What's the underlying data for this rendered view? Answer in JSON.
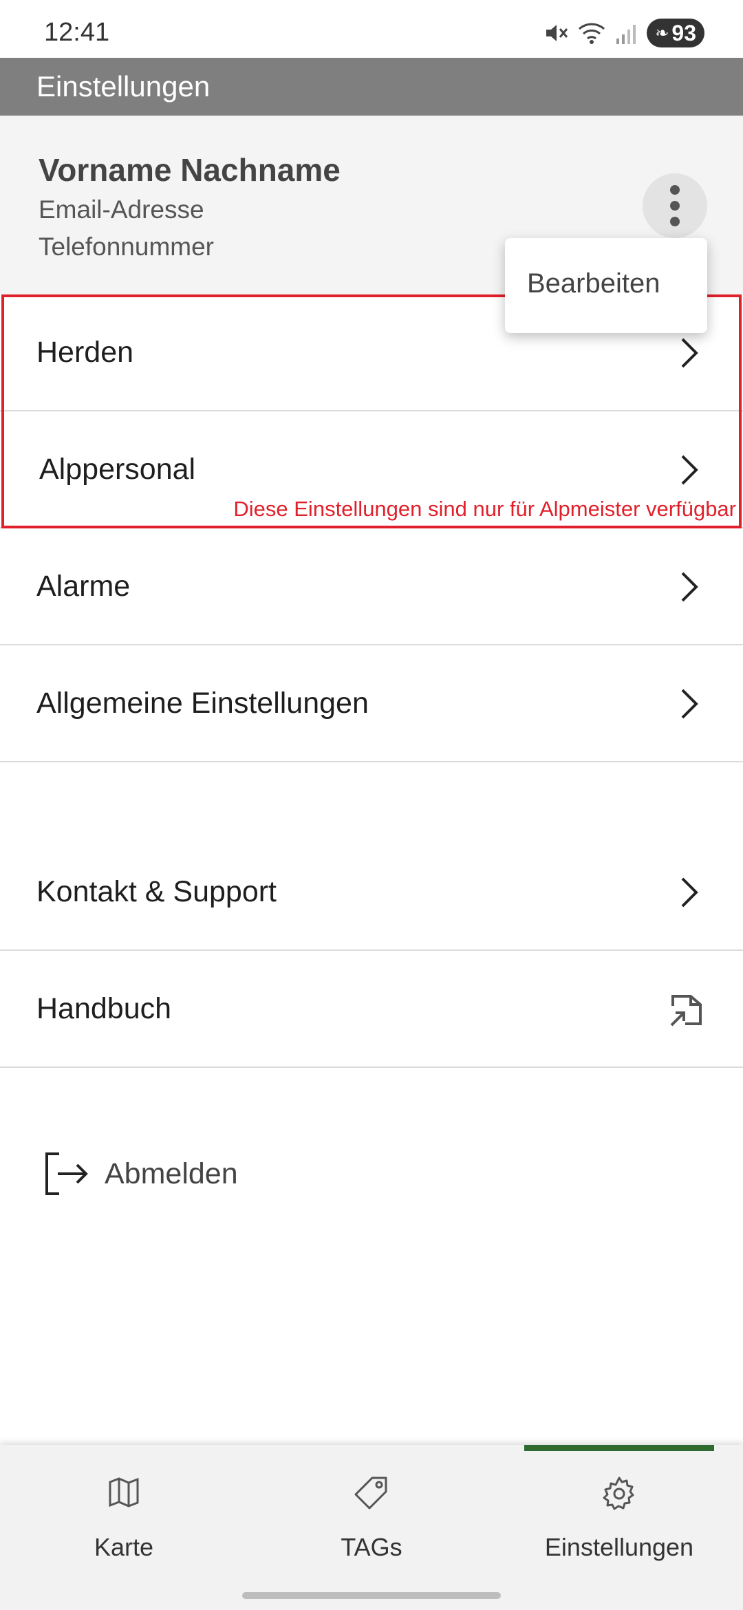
{
  "status_bar": {
    "time": "12:41",
    "battery": "93"
  },
  "app_bar": {
    "title": "Einstellungen"
  },
  "profile": {
    "name": "Vorname Nachname",
    "email": "Email-Adresse",
    "phone": "Telefonnummer"
  },
  "popup_menu": {
    "edit_label": "Bearbeiten"
  },
  "menu": {
    "herds": "Herden",
    "staff": "Alppersonal",
    "alarms": "Alarme",
    "general": "Allgemeine Einstellungen",
    "contact": "Kontakt & Support",
    "manual": "Handbuch"
  },
  "admin_note": "Diese Einstellungen sind nur für Alpmeister verfügbar",
  "logout": {
    "label": "Abmelden"
  },
  "bottom_nav": {
    "items": [
      {
        "label": "Karte",
        "icon": "map-icon"
      },
      {
        "label": "TAGs",
        "icon": "tag-icon"
      },
      {
        "label": "Einstellungen",
        "icon": "gear-icon"
      }
    ],
    "active_index": 2
  },
  "colors": {
    "app_bar": "#7f7f7f",
    "highlight": "#e0202a",
    "active_tab": "#2f6b2f"
  }
}
